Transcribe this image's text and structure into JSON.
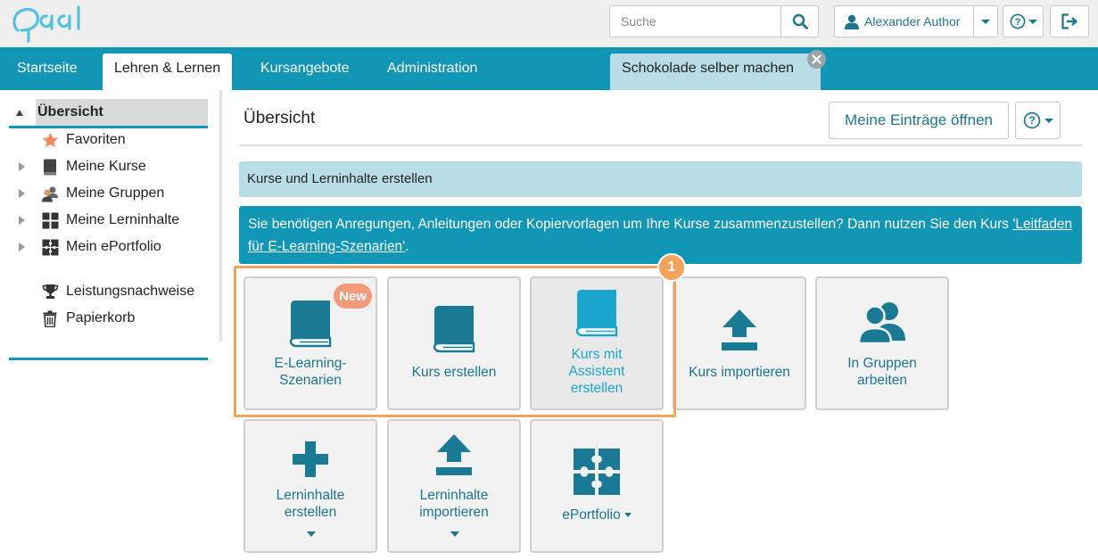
{
  "app": {
    "logo_text": "Opal"
  },
  "header": {
    "search": {
      "placeholder": "Suche",
      "value": ""
    },
    "user_name": "Alexander Author",
    "help_label": "?"
  },
  "nav": {
    "tabs": [
      {
        "label": "Startseite",
        "active": false
      },
      {
        "label": "Lehren & Lernen",
        "active": true
      },
      {
        "label": "Kursangebote",
        "active": false
      },
      {
        "label": "Administration",
        "active": false
      }
    ],
    "open_course_tab": {
      "label": "Schokolade selber machen"
    }
  },
  "sidebar": {
    "root": {
      "label": "Übersicht",
      "expanded": true
    },
    "items": [
      {
        "label": "Favoriten",
        "icon": "star-icon",
        "expandable": false
      },
      {
        "label": "Meine Kurse",
        "icon": "book-icon",
        "expandable": true
      },
      {
        "label": "Meine Gruppen",
        "icon": "group-icon",
        "expandable": true
      },
      {
        "label": "Meine Lerninhalte",
        "icon": "grid-icon",
        "expandable": true
      },
      {
        "label": "Mein ePortfolio",
        "icon": "puzzle-icon",
        "expandable": true
      }
    ],
    "extra_items": [
      {
        "label": "Leistungsnachweise",
        "icon": "trophy-icon"
      },
      {
        "label": "Papierkorb",
        "icon": "trash-icon"
      }
    ]
  },
  "main": {
    "title": "Übersicht",
    "open_entries_button": "Meine Einträge öffnen",
    "section_heading": "Kurse und Lerninhalte erstellen",
    "info": {
      "text_before": "Sie benötigen Anregungen, Anleitungen oder Kopiervorlagen um Ihre Kurse zusammenzustellen? Dann nutzen Sie den Kurs ",
      "link_text": "'Leitfaden für E-Learning-Szenarien'",
      "text_after": "."
    },
    "step_number": "1",
    "tiles": [
      {
        "line1": "E-Learning-",
        "line2": "Szenarien",
        "icon": "book-icon",
        "badge": "New"
      },
      {
        "line1": "Kurs erstellen",
        "icon": "book-icon"
      },
      {
        "line1": "Kurs mit",
        "line2": "Assistent",
        "line3": "erstellen",
        "icon": "book-icon",
        "selected": true
      },
      {
        "line1": "Kurs importieren",
        "icon": "upload-icon"
      },
      {
        "line1": "In Gruppen",
        "line2": "arbeiten",
        "icon": "users-icon"
      },
      {
        "line1": "Lerninhalte",
        "line2": "erstellen",
        "icon": "plus-icon",
        "dropdown": true
      },
      {
        "line1": "Lerninhalte",
        "line2": "importieren",
        "icon": "upload-icon",
        "dropdown": true
      },
      {
        "line1": "ePortfolio",
        "icon": "puzzle-icon",
        "dropdown": true
      }
    ]
  },
  "colors": {
    "primary": "#1196b5",
    "text_link": "#1c7690",
    "icon_dark": "#1a7a93",
    "icon_light": "#1aa6cc",
    "highlight": "#f2a45c",
    "new_badge": "#f39a7a",
    "course_tab_bg": "#b9dde7"
  }
}
